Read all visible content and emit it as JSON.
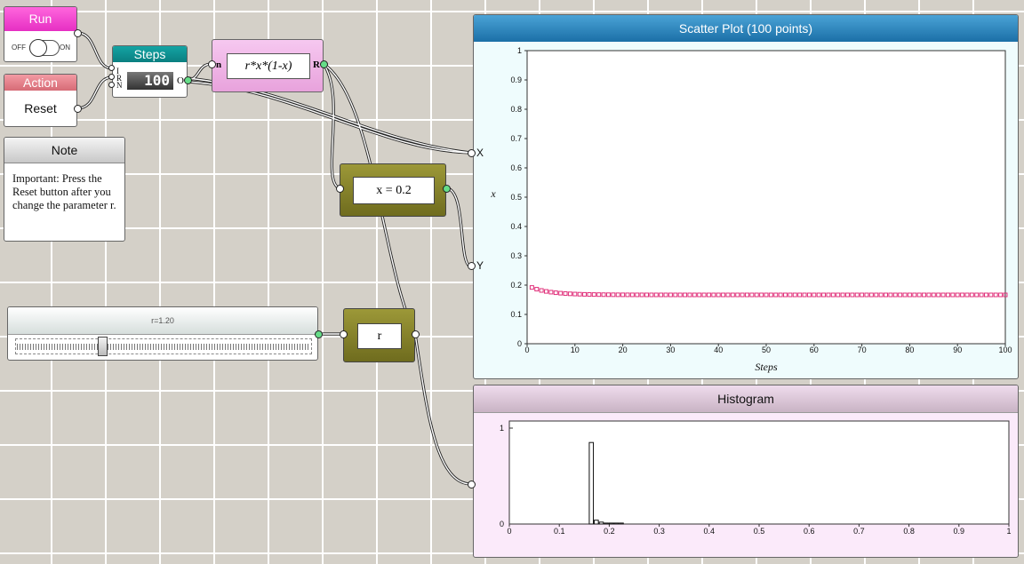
{
  "run": {
    "title": "Run",
    "off_label": "OFF",
    "on_label": "ON"
  },
  "action": {
    "title": "Action",
    "button_label": "Reset"
  },
  "note": {
    "title": "Note",
    "text": "Important: Press the Reset button after you change the parameter r."
  },
  "steps": {
    "title": "Steps",
    "value": "100",
    "in_ports": [
      "I",
      "R",
      "N"
    ],
    "out_port": "O"
  },
  "formula": {
    "expression": "r*x*(1-x)",
    "in_port": "n",
    "out_port": "R"
  },
  "x_init": {
    "expression": "x = 0.2"
  },
  "r_param": {
    "label": "r"
  },
  "slider": {
    "label": "r=1.20",
    "value": 1.2
  },
  "scatter_inputs": {
    "x_label": "X",
    "y_label": "Y"
  },
  "scatter": {
    "title": "Scatter Plot (100 points)",
    "chart_data": {
      "type": "scatter",
      "xlabel": "Steps",
      "ylabel": "x",
      "xlim": [
        0,
        100
      ],
      "ylim": [
        0,
        1
      ],
      "x_ticks": [
        "0",
        "10",
        "20",
        "30",
        "40",
        "50",
        "60",
        "70",
        "80",
        "90",
        "100"
      ],
      "y_ticks": [
        "0",
        "0.1",
        "0.2",
        "0.3",
        "0.4",
        "0.5",
        "0.6",
        "0.7",
        "0.8",
        "0.9",
        "1"
      ],
      "marker_color": "#e0307a",
      "r": 1.2,
      "x0": 0.2,
      "points": 100
    }
  },
  "histogram": {
    "title": "Histogram",
    "chart_data": {
      "type": "bar",
      "xlim": [
        0,
        1
      ],
      "ylim": [
        0,
        1
      ],
      "x_ticks": [
        "0",
        "0.1",
        "0.2",
        "0.3",
        "0.4",
        "0.5",
        "0.6",
        "0.7",
        "0.8",
        "0.9",
        "1"
      ],
      "y_ticks": [
        "0",
        "1"
      ],
      "bins": [
        {
          "x0": 0.16,
          "x1": 0.17,
          "value": 0.85
        },
        {
          "x0": 0.17,
          "x1": 0.18,
          "value": 0.04
        },
        {
          "x0": 0.18,
          "x1": 0.19,
          "value": 0.02
        },
        {
          "x0": 0.19,
          "x1": 0.2,
          "value": 0.01
        },
        {
          "x0": 0.2,
          "x1": 0.21,
          "value": 0.01
        },
        {
          "x0": 0.21,
          "x1": 0.22,
          "value": 0.01
        },
        {
          "x0": 0.22,
          "x1": 0.23,
          "value": 0.01
        }
      ]
    }
  }
}
